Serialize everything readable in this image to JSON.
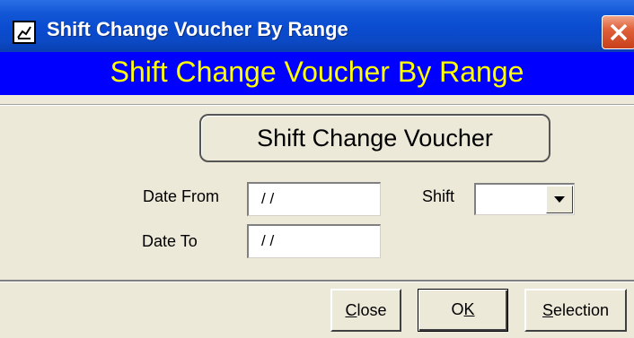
{
  "window": {
    "title": "Shift Change Voucher By Range",
    "icon": "report-icon",
    "close_icon": "close-icon",
    "colors": {
      "titlebar": "#0a4bd0",
      "header_band": "#0000ff",
      "header_text": "#ffff00",
      "close": "#e0613b"
    }
  },
  "header": {
    "title": "Shift Change Voucher By Range"
  },
  "main": {
    "voucher_button_label": "Shift Change Voucher",
    "date_from": {
      "label": "Date From",
      "value": " / /"
    },
    "date_to": {
      "label": "Date To",
      "value": " / /"
    },
    "shift": {
      "label": "Shift",
      "value": "",
      "dropdown_icon": "chevron-down-icon"
    }
  },
  "footer": {
    "close": {
      "accel": "C",
      "rest": "lose"
    },
    "ok": {
      "prefix": "O",
      "accel": "K"
    },
    "selection": {
      "accel": "S",
      "rest": "election"
    }
  }
}
